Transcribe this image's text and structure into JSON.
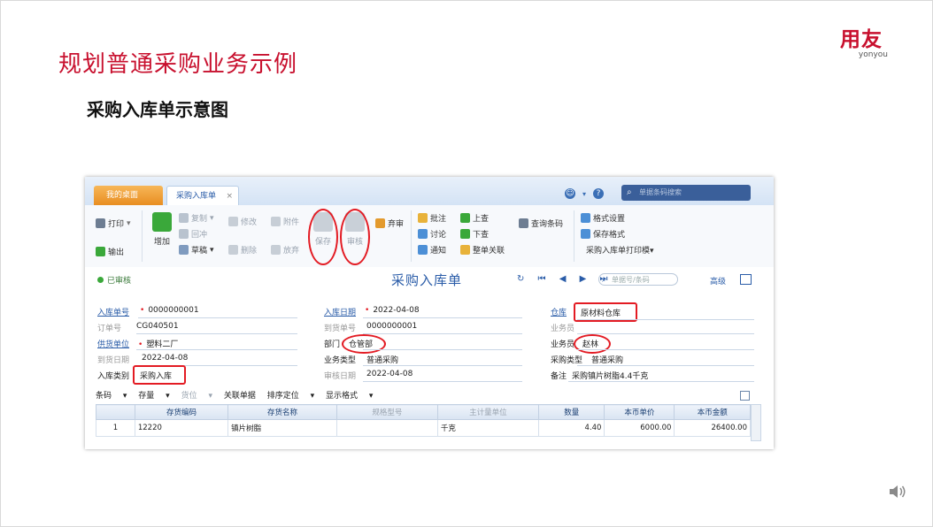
{
  "slide": {
    "title": "规划普通采购业务示例",
    "subtitle": "采购入库单示意图",
    "logo_main": "用友",
    "logo_sub": "yonyou"
  },
  "tabs": {
    "home": "我的桌面",
    "active": "采购入库单",
    "close": "×",
    "search_placeholder": "单据条码搜索"
  },
  "toolbar": {
    "print": "打印",
    "export": "输出",
    "add": "增加",
    "copy": "复制",
    "back": "回冲",
    "draft": "草稿",
    "modify": "修改",
    "delete": "删除",
    "attach": "附件",
    "abandon": "放弃",
    "save": "保存",
    "audit": "审核",
    "discard": "弃审",
    "approve": "批注",
    "discuss": "讨论",
    "notify": "通知",
    "prev_up": "上查",
    "prev_down": "下查",
    "linkall": "整单关联",
    "query_barcode": "查询条码",
    "format_set": "格式设置",
    "save_format": "保存格式",
    "print_template": "采购入库单打印模▾"
  },
  "status": {
    "state": "已审核",
    "form_title": "采购入库单",
    "nav_arrows": "↻ ⏮ ◀ ▶ ⏭",
    "search_placeholder": "单据号/条码",
    "advanced": "高级"
  },
  "form": {
    "receipt_no_label": "入库单号",
    "receipt_no": "0000000001",
    "order_no_label": "订单号",
    "order_no": "CG040501",
    "supplier_label": "供货单位",
    "supplier": "塑料二厂",
    "arrival_date_label": "到货日期",
    "arrival_date": "2022-04-08",
    "receipt_type_label": "入库类别",
    "receipt_type": "采购入库",
    "receipt_date_label": "入库日期",
    "receipt_date": "2022-04-08",
    "arrival_no_label": "到货单号",
    "arrival_no": "0000000001",
    "dept_label": "部门",
    "dept": "仓管部",
    "biz_type_label": "业务类型",
    "biz_type": "普通采购",
    "audit_date_label": "审核日期",
    "audit_date": "2022-04-08",
    "warehouse_label": "仓库",
    "warehouse": "原材料仓库",
    "salesman_label": "业务员",
    "salesperson_label": "业务员",
    "salesperson": "赵林",
    "purchase_type_label": "采购类型",
    "purchase_type": "普通采购",
    "remark_label": "备注",
    "remark": "采购镇片树脂4.4千克"
  },
  "grid_toolbar": {
    "barcode": "条码",
    "stock": "存量",
    "batch": "货位",
    "related": "关联单据",
    "sort": "排序定位",
    "display": "显示格式"
  },
  "grid": {
    "headers": [
      "存货编码",
      "存货名称",
      "规格型号",
      "主计量单位",
      "数量",
      "本币单价",
      "本币金额"
    ],
    "rows": [
      {
        "no": "1",
        "code": "12220",
        "name": "镇片树脂",
        "spec": "",
        "unit": "千克",
        "qty": "4.40",
        "price": "6000.00",
        "amount": "26400.00"
      }
    ]
  }
}
